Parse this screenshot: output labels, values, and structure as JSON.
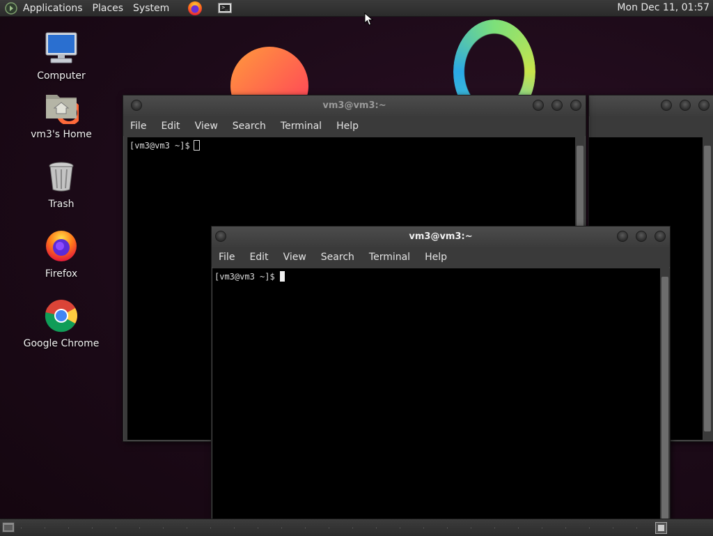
{
  "top_panel": {
    "menus": [
      "Applications",
      "Places",
      "System"
    ],
    "clock": "Mon Dec 11, 01:57",
    "launchers": [
      "firefox-icon",
      "terminal-icon"
    ]
  },
  "desktop_icons": [
    {
      "label": "Computer",
      "icon": "computer-icon"
    },
    {
      "label": "vm3's Home",
      "icon": "home-folder-icon"
    },
    {
      "label": "Trash",
      "icon": "trash-icon"
    },
    {
      "label": "Firefox",
      "icon": "firefox-icon"
    },
    {
      "label": "Google Chrome",
      "icon": "chrome-icon"
    }
  ],
  "terminal_back": {
    "title": "vm3@vm3:~",
    "menu": [
      "File",
      "Edit",
      "View",
      "Search",
      "Terminal",
      "Help"
    ],
    "prompt": "[vm3@vm3 ~]$"
  },
  "terminal_front": {
    "title": "vm3@vm3:~",
    "menu": [
      "File",
      "Edit",
      "View",
      "Search",
      "Terminal",
      "Help"
    ],
    "prompt": "[vm3@vm3 ~]$"
  },
  "colors": {
    "desktop_bg": "#1c0a18",
    "panel": "#2f2f2f",
    "terminal_bg": "#000000",
    "window_chrome": "#3a3a3a"
  }
}
